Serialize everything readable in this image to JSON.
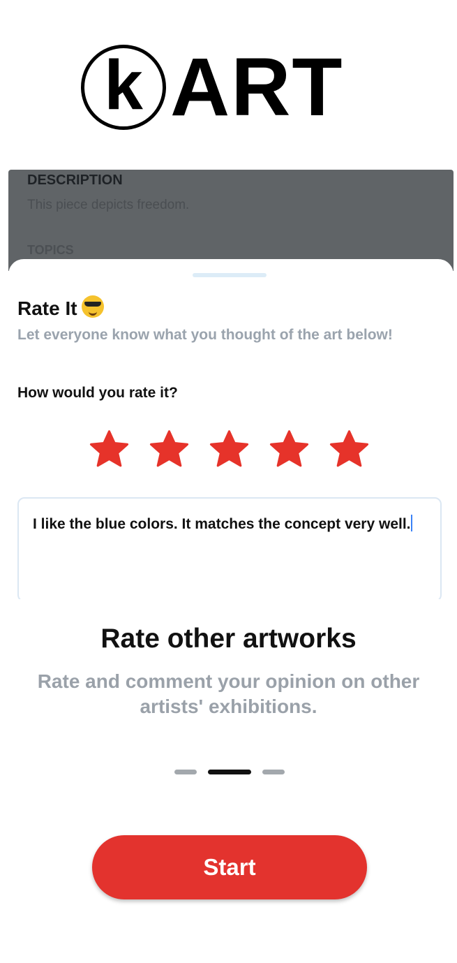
{
  "logo": {
    "letter": "k",
    "word": "ART"
  },
  "preview": {
    "background": {
      "description_label": "DESCRIPTION",
      "description_text": "This piece depicts freedom.",
      "topics_label": "TOPICS"
    },
    "rate_sheet": {
      "title": "Rate It",
      "emoji_icon": "sunglasses-face-icon",
      "subtitle": "Let everyone know what you thought of the art below!",
      "question": "How would you rate it?",
      "rating": 5,
      "rating_max": 5,
      "star_color": "#e6332a",
      "comment": "I like the blue colors. It matches the concept very well."
    }
  },
  "onboarding": {
    "headline": "Rate other artworks",
    "subtext": "Rate and comment your opinion on other artists' exhibitions.",
    "page_index": 2,
    "page_count": 3
  },
  "start_button": {
    "label": "Start",
    "color": "#e3332e"
  }
}
